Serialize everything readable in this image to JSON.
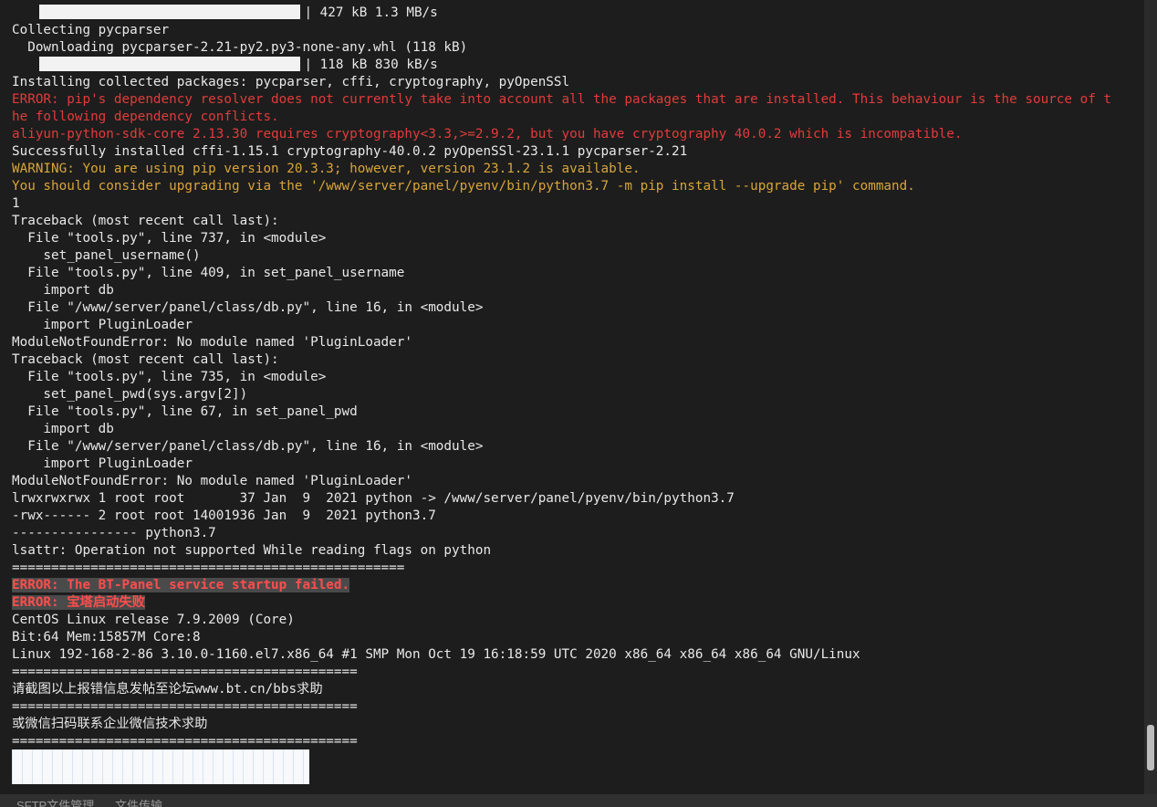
{
  "terminal": {
    "lines": [
      {
        "text": "| 427 kB 1.3 MB/s",
        "style": "bar",
        "indent": "    "
      },
      {
        "text": "Collecting pycparser",
        "style": "normal"
      },
      {
        "text": "  Downloading pycparser-2.21-py2.py3-none-any.whl (118 kB)",
        "style": "normal"
      },
      {
        "text": "| 118 kB 830 kB/s",
        "style": "bar",
        "indent": "    "
      },
      {
        "text": "Installing collected packages: pycparser, cffi, cryptography, pyOpenSSl",
        "style": "normal"
      },
      {
        "text": "ERROR: pip's dependency resolver does not currently take into account all the packages that are installed. This behaviour is the source of t",
        "style": "err"
      },
      {
        "text": "he following dependency conflicts.",
        "style": "err"
      },
      {
        "text": "aliyun-python-sdk-core 2.13.30 requires cryptography<3.3,>=2.9.2, but you have cryptography 40.0.2 which is incompatible.",
        "style": "err"
      },
      {
        "text": "Successfully installed cffi-1.15.1 cryptography-40.0.2 pyOpenSSl-23.1.1 pycparser-2.21",
        "style": "normal"
      },
      {
        "text": "WARNING: You are using pip version 20.3.3; however, version 23.1.2 is available.",
        "style": "warn"
      },
      {
        "text": "You should consider upgrading via the '/www/server/panel/pyenv/bin/python3.7 -m pip install --upgrade pip' command.",
        "style": "warn"
      },
      {
        "text": "1",
        "style": "normal"
      },
      {
        "text": "Traceback (most recent call last):",
        "style": "normal"
      },
      {
        "text": "  File \"tools.py\", line 737, in <module>",
        "style": "normal"
      },
      {
        "text": "    set_panel_username()",
        "style": "normal"
      },
      {
        "text": "  File \"tools.py\", line 409, in set_panel_username",
        "style": "normal"
      },
      {
        "text": "    import db",
        "style": "normal"
      },
      {
        "text": "  File \"/www/server/panel/class/db.py\", line 16, in <module>",
        "style": "normal"
      },
      {
        "text": "    import PluginLoader",
        "style": "normal"
      },
      {
        "text": "ModuleNotFoundError: No module named 'PluginLoader'",
        "style": "normal"
      },
      {
        "text": "Traceback (most recent call last):",
        "style": "normal"
      },
      {
        "text": "  File \"tools.py\", line 735, in <module>",
        "style": "normal"
      },
      {
        "text": "    set_panel_pwd(sys.argv[2])",
        "style": "normal"
      },
      {
        "text": "  File \"tools.py\", line 67, in set_panel_pwd",
        "style": "normal"
      },
      {
        "text": "    import db",
        "style": "normal"
      },
      {
        "text": "  File \"/www/server/panel/class/db.py\", line 16, in <module>",
        "style": "normal"
      },
      {
        "text": "    import PluginLoader",
        "style": "normal"
      },
      {
        "text": "ModuleNotFoundError: No module named 'PluginLoader'",
        "style": "normal"
      },
      {
        "text": "lrwxrwxrwx 1 root root       37 Jan  9  2021 python -> /www/server/panel/pyenv/bin/python3.7",
        "style": "normal"
      },
      {
        "text": "-rwx------ 2 root root 14001936 Jan  9  2021 python3.7",
        "style": "normal"
      },
      {
        "text": "---------------- python3.7",
        "style": "normal"
      },
      {
        "text": "lsattr: Operation not supported While reading flags on python",
        "style": "normal"
      },
      {
        "text": "==================================================",
        "style": "normal"
      },
      {
        "text": "ERROR: The BT-Panel service startup failed.",
        "style": "hl"
      },
      {
        "text": "ERROR: 宝塔启动失败",
        "style": "hl"
      },
      {
        "text": "CentOS Linux release 7.9.2009 (Core)",
        "style": "normal"
      },
      {
        "text": "Bit:64 Mem:15857M Core:8",
        "style": "normal"
      },
      {
        "text": "Linux 192-168-2-86 3.10.0-1160.el7.x86_64 #1 SMP Mon Oct 19 16:18:59 UTC 2020 x86_64 x86_64 x86_64 GNU/Linux",
        "style": "normal"
      },
      {
        "text": "============================================",
        "style": "normal"
      },
      {
        "text": "请截图以上报错信息发帖至论坛www.bt.cn/bbs求助",
        "style": "normal"
      },
      {
        "text": "============================================",
        "style": "normal"
      },
      {
        "text": "或微信扫码联系企业微信技术求助",
        "style": "normal"
      },
      {
        "text": "============================================",
        "style": "normal"
      }
    ]
  },
  "tabs": [
    {
      "label": "SFTP文件管理"
    },
    {
      "label": "文件传输"
    }
  ],
  "colors": {
    "background": "#1d1d1d",
    "text": "#e8e8e8",
    "error": "#e23b3b",
    "warning": "#d9a43a",
    "highlight_bg": "#4a4a4a"
  }
}
